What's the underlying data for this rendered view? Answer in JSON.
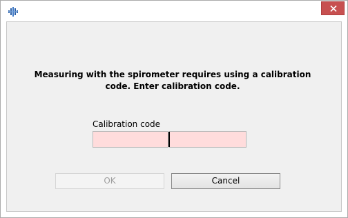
{
  "window": {
    "icon": "app-icon",
    "close_icon": "close-icon",
    "close_color": "#c75050"
  },
  "dialog": {
    "message": "Measuring with the spirometer requires using a calibration code. Enter calibration code.",
    "calibration_label": "Calibration code",
    "code_part1": "",
    "code_part2": "",
    "input_background": "#ffdcdc",
    "ok_label": "OK",
    "ok_enabled": false,
    "cancel_label": "Cancel"
  }
}
